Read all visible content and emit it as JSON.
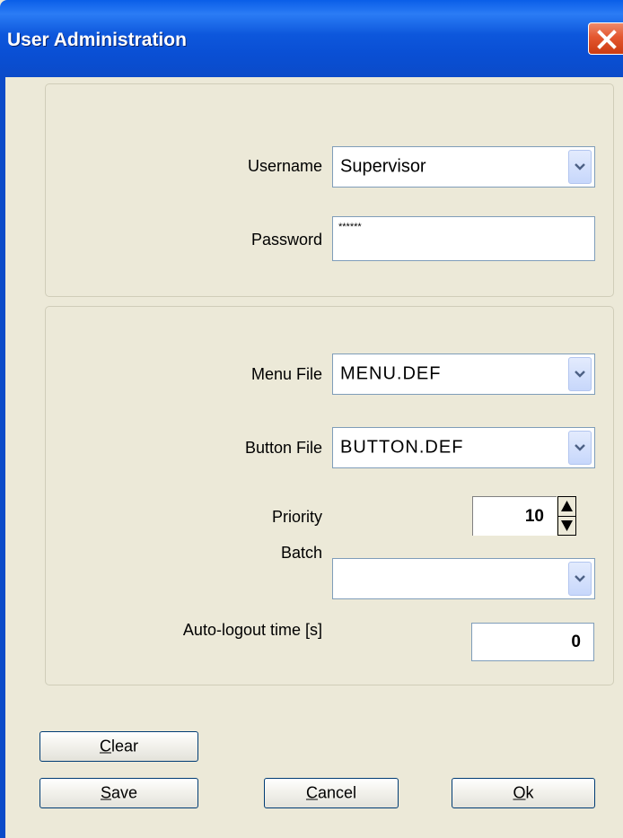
{
  "window": {
    "title": "User Administration",
    "close_icon": "close-icon"
  },
  "login": {
    "username_label": "Username",
    "username_value": "Supervisor",
    "password_label": "Password",
    "password_value": "******"
  },
  "settings": {
    "menu_file_label": "Menu File",
    "menu_file_value": "MENU.DEF",
    "button_file_label": "Button File",
    "button_file_value": "BUTTON.DEF",
    "priority_label": "Priority",
    "priority_value": "10",
    "batch_label": "Batch",
    "batch_value": "",
    "autologout_label": "Auto-logout time [s]",
    "autologout_value": "0"
  },
  "buttons": {
    "clear": {
      "accel": "C",
      "rest": "lear"
    },
    "save": {
      "accel": "S",
      "rest": "ave"
    },
    "cancel": {
      "accel": "C",
      "rest": "ancel"
    },
    "ok": {
      "accel": "O",
      "rest": "k"
    }
  },
  "colors": {
    "titlebar": "#0a4fd4",
    "close_button": "#e4572f",
    "face": "#ece9d8",
    "field_border": "#7f9db9"
  }
}
